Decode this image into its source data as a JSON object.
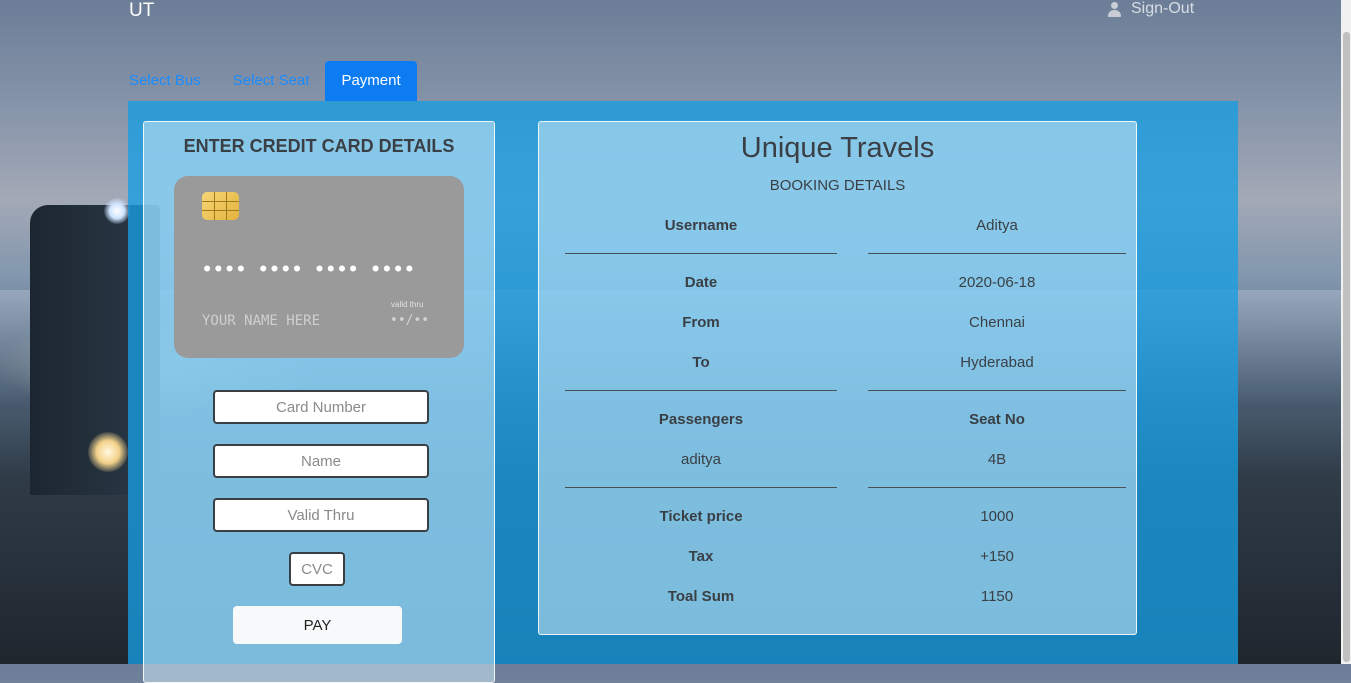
{
  "header": {
    "brand": "UT",
    "signout_label": "Sign-Out",
    "user_icon": "user-icon"
  },
  "tabs": [
    {
      "label": "Select Bus",
      "active": false
    },
    {
      "label": "Select Seat",
      "active": false
    },
    {
      "label": "Payment",
      "active": true
    }
  ],
  "payment": {
    "title": "ENTER CREDIT CARD DETAILS",
    "card_preview": {
      "number_mask": "•••• •••• •••• ••••",
      "name_placeholder": "YOUR NAME HERE",
      "valid_label": "valid thru",
      "valid_mask": "••/••",
      "chip_icon": "chip-icon",
      "card_color": "#9a9a9a"
    },
    "fields": {
      "card_number": {
        "placeholder": "Card Number",
        "value": ""
      },
      "name": {
        "placeholder": "Name",
        "value": ""
      },
      "valid_thru": {
        "placeholder": "Valid Thru",
        "value": ""
      },
      "cvc": {
        "placeholder": "CVC",
        "value": ""
      }
    },
    "pay_label": "PAY"
  },
  "booking": {
    "title": "Unique Travels",
    "subtitle": "BOOKING DETAILS",
    "username_label": "Username",
    "username": "Aditya",
    "date_label": "Date",
    "date": "2020-06-18",
    "from_label": "From",
    "from": "Chennai",
    "to_label": "To",
    "to": "Hyderabad",
    "passengers_label": "Passengers",
    "seat_label": "Seat No",
    "passenger": "aditya",
    "seat": "4B",
    "ticket_price_label": "Ticket price",
    "ticket_price": "1000",
    "tax_label": "Tax",
    "tax": "+150",
    "total_label": "Toal Sum",
    "total": "1150"
  },
  "colors": {
    "accent": "#0d7bf2",
    "panel": "#179ee2",
    "link": "#1a8cff"
  }
}
